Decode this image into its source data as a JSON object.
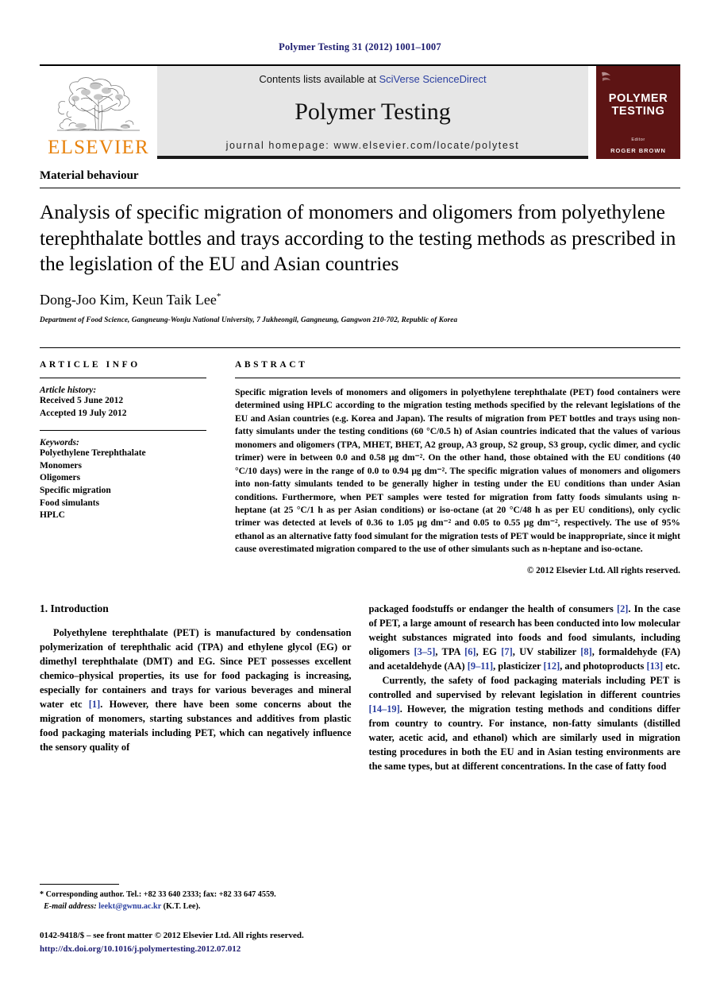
{
  "running_head": "Polymer Testing 31 (2012) 1001–1007",
  "banner": {
    "contents_prefix": "Contents lists available at ",
    "contents_link": "SciVerse ScienceDirect",
    "journal_name": "Polymer Testing",
    "homepage": "journal homepage: www.elsevier.com/locate/polytest",
    "publisher_wordmark": "ELSEVIER",
    "cover": {
      "title_line1": "POLYMER",
      "title_line2": "TESTING",
      "editor_label": "Editor",
      "editor_name": "ROGER BROWN"
    },
    "link_color": "#2b3fa0",
    "cover_color": "#5d1414",
    "wordmark_color": "#E8820C"
  },
  "article": {
    "section_label": "Material behaviour",
    "title": "Analysis of specific migration of monomers and oligomers from polyethylene terephthalate bottles and trays according to the testing methods as prescribed in the legislation of the EU and Asian countries",
    "authors": "Dong-Joo Kim, Keun Taik Lee",
    "corresponding_marker": "*",
    "affiliation": "Department of Food Science, Gangneung-Wonju National University, 7 Jukheongil, Gangneung, Gangwon 210-702, Republic of Korea"
  },
  "article_info": {
    "heading": "ARTICLE INFO",
    "history_label": "Article history:",
    "received": "Received 5 June 2012",
    "accepted": "Accepted 19 July 2012",
    "keywords_label": "Keywords:",
    "keywords": [
      "Polyethylene Terephthalate",
      "Monomers",
      "Oligomers",
      "Specific migration",
      "Food simulants",
      "HPLC"
    ]
  },
  "abstract": {
    "heading": "ABSTRACT",
    "text": "Specific migration levels of monomers and oligomers in polyethylene terephthalate (PET) food containers were determined using HPLC according to the migration testing methods specified by the relevant legislations of the EU and Asian countries (e.g. Korea and Japan). The results of migration from PET bottles and trays using non-fatty simulants under the testing conditions (60 °C/0.5 h) of Asian countries indicated that the values of various monomers and oligomers (TPA, MHET, BHET, A2 group, A3 group, S2 group, S3 group, cyclic dimer, and cyclic trimer) were in between 0.0 and 0.58 μg dm⁻². On the other hand, those obtained with the EU conditions (40 °C/10 days) were in the range of 0.0 to 0.94 μg dm⁻². The specific migration values of monomers and oligomers into non-fatty simulants tended to be generally higher in testing under the EU conditions than under Asian conditions. Furthermore, when PET samples were tested for migration from fatty foods simulants using n-heptane (at 25 °C/1 h as per Asian conditions) or iso-octane (at 20 °C/48 h as per EU conditions), only cyclic trimer was detected at levels of 0.36 to 1.05 μg dm⁻² and 0.05 to 0.55 μg dm⁻², respectively. The use of 95% ethanol as an alternative fatty food simulant for the migration tests of PET would be inappropriate, since it might cause overestimated migration compared to the use of other simulants such as n-heptane and iso-octane.",
    "copyright": "© 2012 Elsevier Ltd. All rights reserved."
  },
  "introduction": {
    "heading": "1. Introduction",
    "left_paragraph": "Polyethylene terephthalate (PET) is manufactured by condensation polymerization of terephthalic acid (TPA) and ethylene glycol (EG) or dimethyl terephthalate (DMT) and EG. Since PET possesses excellent chemico–physical properties, its use for food packaging is increasing, especially for containers and trays for various beverages and mineral water etc [1]. However, there have been some concerns about the migration of monomers, starting substances and additives from plastic food packaging materials including PET, which can negatively influence the sensory quality of",
    "right_paragraph_1": "packaged foodstuffs or endanger the health of consumers [2]. In the case of PET, a large amount of research has been conducted into low molecular weight substances migrated into foods and food simulants, including oligomers [3–5], TPA [6], EG [7], UV stabilizer [8], formaldehyde (FA) and acetaldehyde (AA) [9–11], plasticizer [12], and photoproducts [13] etc.",
    "right_paragraph_2": "Currently, the safety of food packaging materials including PET is controlled and supervised by relevant legislation in different countries [14–19]. However, the migration testing methods and conditions differ from country to country. For instance, non-fatty simulants (distilled water, acetic acid, and ethanol) which are similarly used in migration testing procedures in both the EU and in Asian testing environments are the same types, but at different concentrations. In the case of fatty food"
  },
  "footnotes": {
    "corresponding": "* Corresponding author. Tel.: +82 33 640 2333; fax: +82 33 647 4559.",
    "email_label": "E-mail address:",
    "email": "leekt@gwnu.ac.kr",
    "email_suffix": "(K.T. Lee).",
    "front_matter": "0142-9418/$ – see front matter © 2012 Elsevier Ltd. All rights reserved.",
    "doi": "http://dx.doi.org/10.1016/j.polymertesting.2012.07.012"
  }
}
